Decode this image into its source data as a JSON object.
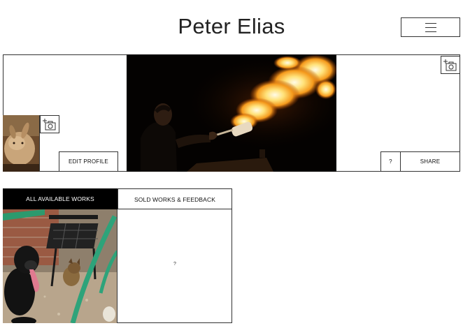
{
  "header": {
    "title": "Peter Elias",
    "menu_icon": "hamburger-icon"
  },
  "cover": {
    "photo_subject": "",
    "change_cover_icon": "add-camera-icon",
    "change_avatar_icon": "add-camera-icon"
  },
  "profile_actions": {
    "edit_profile_label": "EDIT PROFILE",
    "help_label": "?",
    "share_label": "SHARE"
  },
  "tabs": [
    {
      "label": "ALL AVAILABLE WORKS",
      "active": true
    },
    {
      "label": "SOLD WORKS & FEEDBACK",
      "active": false
    }
  ],
  "sold_panel": {
    "placeholder": "?"
  },
  "colors": {
    "border": "#333333",
    "active_tab_bg": "#000000",
    "active_tab_text": "#ffffff",
    "background": "#ffffff"
  }
}
